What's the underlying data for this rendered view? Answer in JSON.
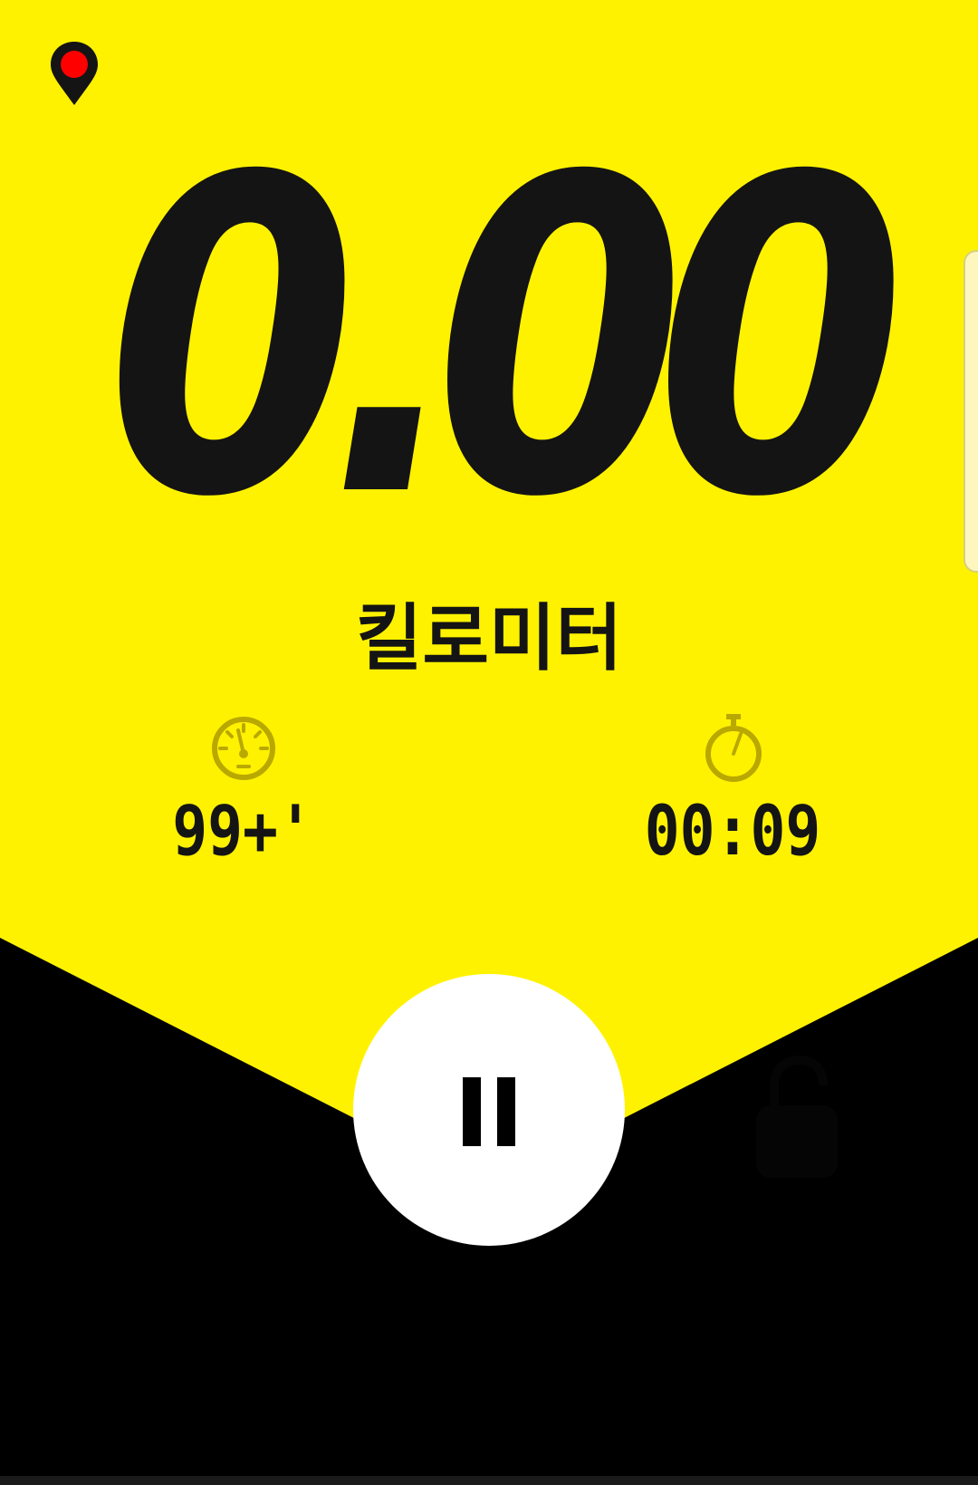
{
  "colors": {
    "accent": "#FFF200",
    "dark": "#000000",
    "text": "#141414",
    "icon_muted": "#B9A800",
    "gps_dot": "#FF0000",
    "button_bg": "#FFFFFF"
  },
  "header": {
    "gps_icon": "map-pin-icon"
  },
  "distance": {
    "value": "0.00",
    "unit": "킬로미터"
  },
  "stats": {
    "pace": {
      "icon": "speedometer-icon",
      "value": "99+'"
    },
    "time": {
      "icon": "stopwatch-icon",
      "value": "00:09"
    }
  },
  "controls": {
    "pause_icon": "pause-icon",
    "lock_icon": "lock-icon"
  }
}
